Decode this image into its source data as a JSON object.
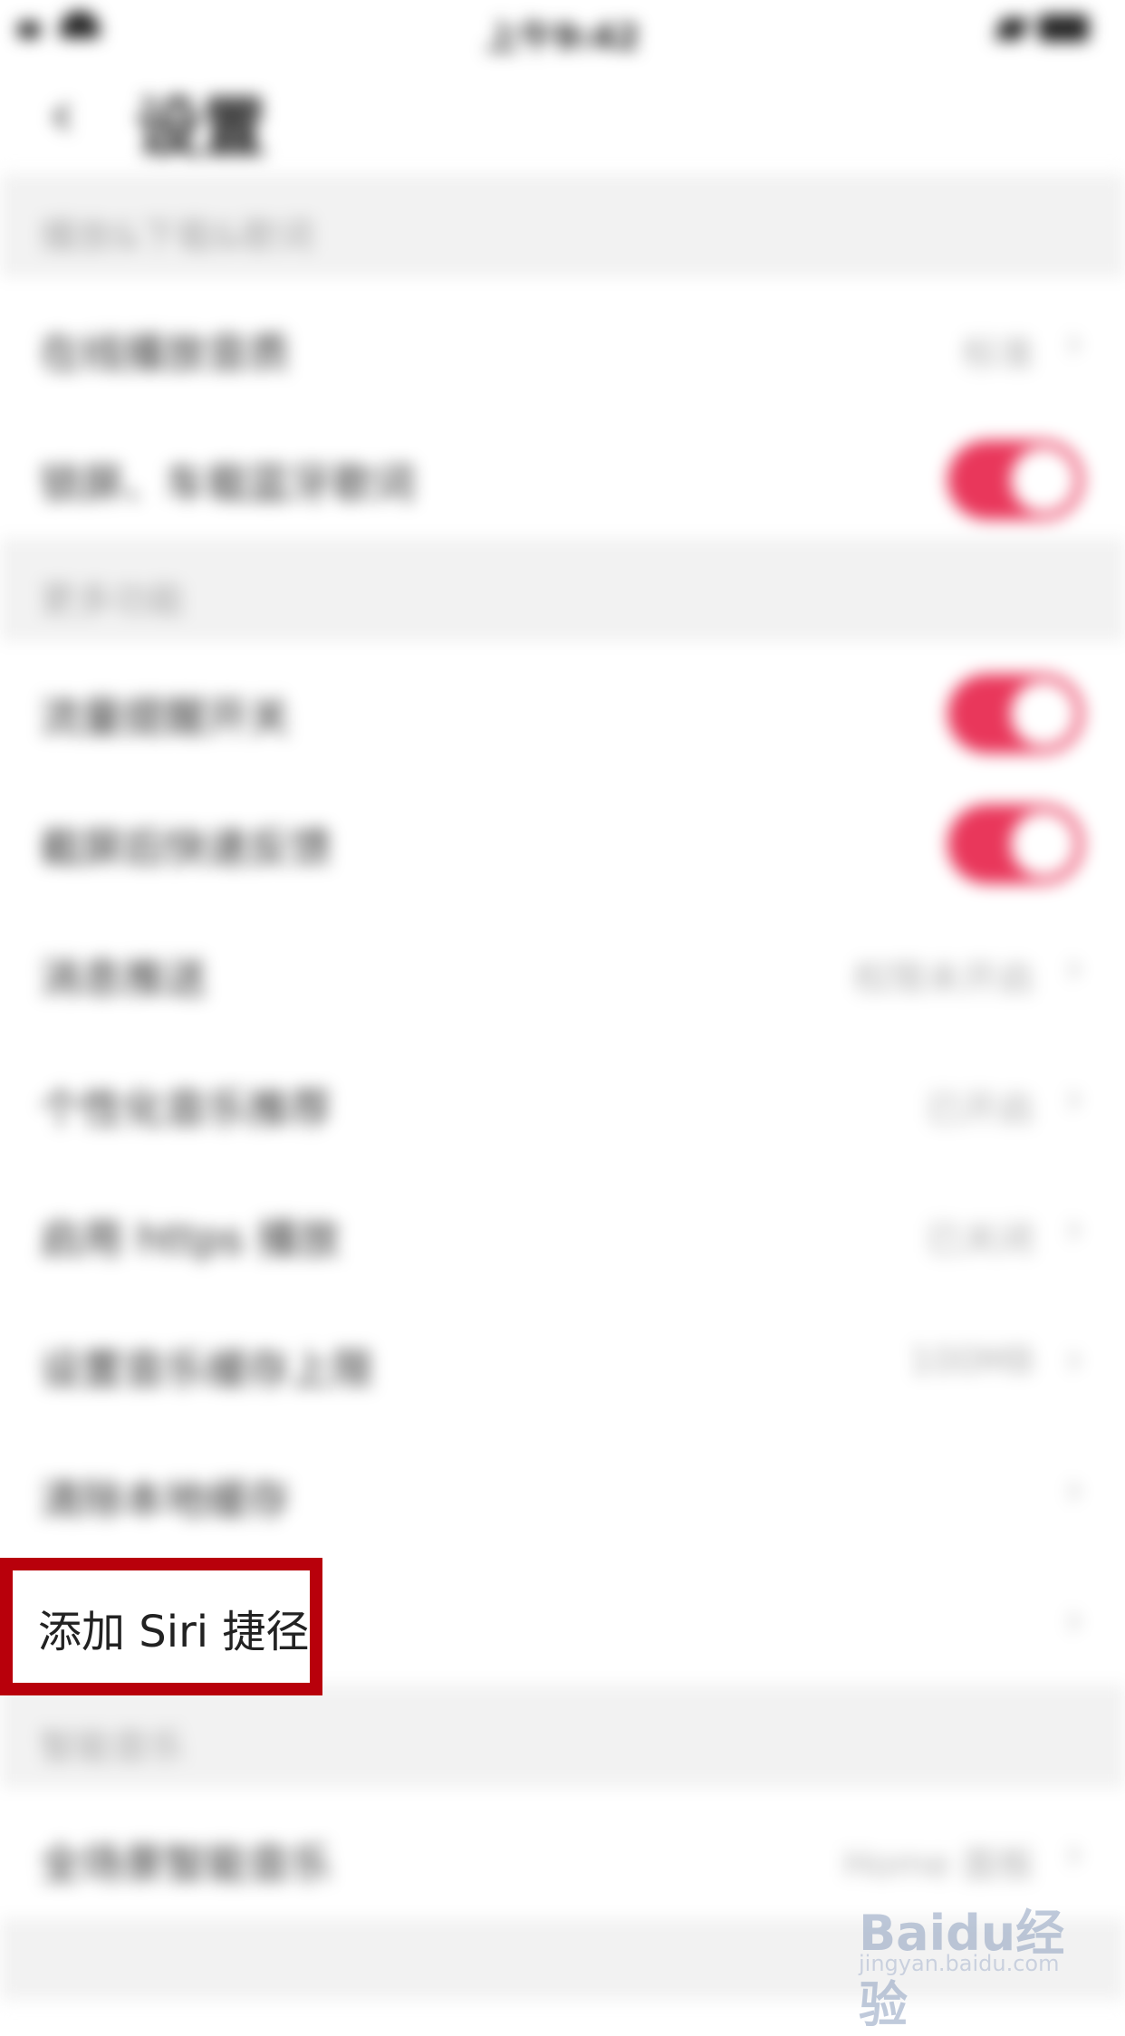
{
  "status_bar": {
    "time": "上午9:42"
  },
  "nav": {
    "back_icon": "chevron-left-icon",
    "title": "设置"
  },
  "sections": {
    "playback": {
      "header": "播放&下载&歌词",
      "online_quality": {
        "label": "在线播放音质",
        "value": "标准"
      },
      "lockscreen_lyrics": {
        "label": "锁屏、车载蓝牙歌词",
        "enabled": true
      }
    },
    "more": {
      "header": "更多功能",
      "traffic_reminder": {
        "label": "流量提醒开关",
        "enabled": true
      },
      "screenshot_feedback": {
        "label": "截屏后快速反馈",
        "enabled": true
      },
      "push": {
        "label": "消息推送",
        "value": "权限未开启"
      },
      "personalized": {
        "label": "个性化音乐推荐",
        "value": "已开启"
      },
      "https": {
        "label": "启用 https 播放",
        "value": "已关闭"
      },
      "cache_limit": {
        "label": "设置音乐缓存上限",
        "value": "100MB"
      },
      "clear_cache": {
        "label": "清除本地缓存"
      },
      "siri": {
        "label": "添加 Siri 捷径"
      }
    },
    "smart": {
      "header": "智能音乐",
      "home_screen": {
        "label": "全场景智能音乐",
        "value": "Home 面板"
      }
    }
  },
  "colors": {
    "accent": "#e9375b",
    "highlight_border": "#b8000b",
    "section_bg": "#f2f2f2"
  },
  "watermark": {
    "brand": "Baidu经验",
    "sub": "jingyan.baidu.com"
  }
}
